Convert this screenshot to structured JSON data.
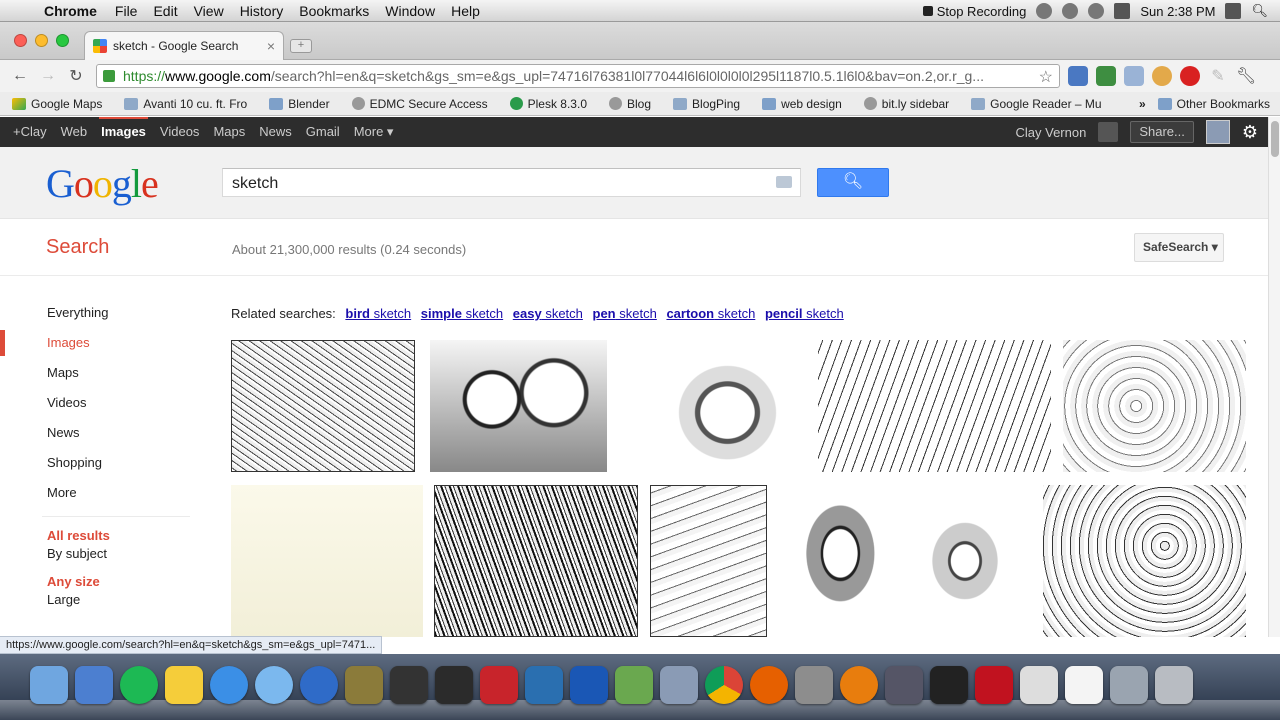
{
  "menubar": {
    "app": "Chrome",
    "menus": [
      "File",
      "Edit",
      "View",
      "History",
      "Bookmarks",
      "Window",
      "Help"
    ],
    "stop_recording": "Stop Recording",
    "clock": "Sun 2:38 PM"
  },
  "tab": {
    "title": "sketch - Google Search",
    "close": "×"
  },
  "omnibox": {
    "scheme": "https://",
    "host": "www.google.com",
    "rest": "/search?hl=en&q=sketch&gs_sm=e&gs_upl=74716l76381l0l77044l6l6l0l0l0l0l295l1187l0.5.1l6l0&bav=on.2,or.r_g..."
  },
  "bookmarks": [
    {
      "label": "Google Maps",
      "icon": "maps-icon"
    },
    {
      "label": "Avanti 10 cu. ft. Fro",
      "icon": "page-icon"
    },
    {
      "label": "Blender",
      "icon": "folder-icon"
    },
    {
      "label": "EDMC Secure Access",
      "icon": "globe-icon"
    },
    {
      "label": "Plesk 8.3.0",
      "icon": "plesk-icon"
    },
    {
      "label": "Blog",
      "icon": "globe-icon"
    },
    {
      "label": "BlogPing",
      "icon": "page-icon"
    },
    {
      "label": "web design",
      "icon": "folder-icon"
    },
    {
      "label": "bit.ly sidebar",
      "icon": "globe-icon"
    },
    {
      "label": "Google Reader – Mu",
      "icon": "page-icon"
    }
  ],
  "bookmarks_more": "»",
  "other_bookmarks": "Other Bookmarks",
  "gbar": {
    "items": [
      "+Clay",
      "Web",
      "Images",
      "Videos",
      "Maps",
      "News",
      "Gmail",
      "More ▾"
    ],
    "user": "Clay Vernon",
    "share": "Share..."
  },
  "search": {
    "query": "sketch",
    "label": "Search",
    "stats": "About 21,300,000 results (0.24 seconds)",
    "safesearch": "SafeSearch ▾"
  },
  "leftnav": {
    "items": [
      "Everything",
      "Images",
      "Maps",
      "Videos",
      "News",
      "Shopping",
      "More"
    ],
    "active_index": 1,
    "filters": [
      {
        "title": "All results",
        "sub": "By subject"
      },
      {
        "title": "Any size",
        "sub": "Large"
      }
    ]
  },
  "related": {
    "prefix": "Related searches:",
    "links": [
      {
        "bold": "bird",
        "rest": " sketch"
      },
      {
        "bold": "simple",
        "rest": " sketch"
      },
      {
        "bold": "easy",
        "rest": " sketch"
      },
      {
        "bold": "pen",
        "rest": " sketch"
      },
      {
        "bold": "cartoon",
        "rest": " sketch"
      },
      {
        "bold": "pencil",
        "rest": " sketch"
      }
    ]
  },
  "images": [
    {
      "name": "image-result-fantasy-collage"
    },
    {
      "name": "image-result-mother-child"
    },
    {
      "name": "image-result-wolf"
    },
    {
      "name": "image-result-graffiti"
    },
    {
      "name": "image-result-doodle-faces"
    },
    {
      "name": "image-result-character-drawings"
    },
    {
      "name": "image-result-ink-trees"
    },
    {
      "name": "image-result-anime-collage"
    },
    {
      "name": "image-result-lion"
    },
    {
      "name": "image-result-dragon"
    },
    {
      "name": "image-result-cheetah"
    }
  ],
  "statusbar": "https://www.google.com/search?hl=en&q=sketch&gs_sm=e&gs_upl=7471..."
}
